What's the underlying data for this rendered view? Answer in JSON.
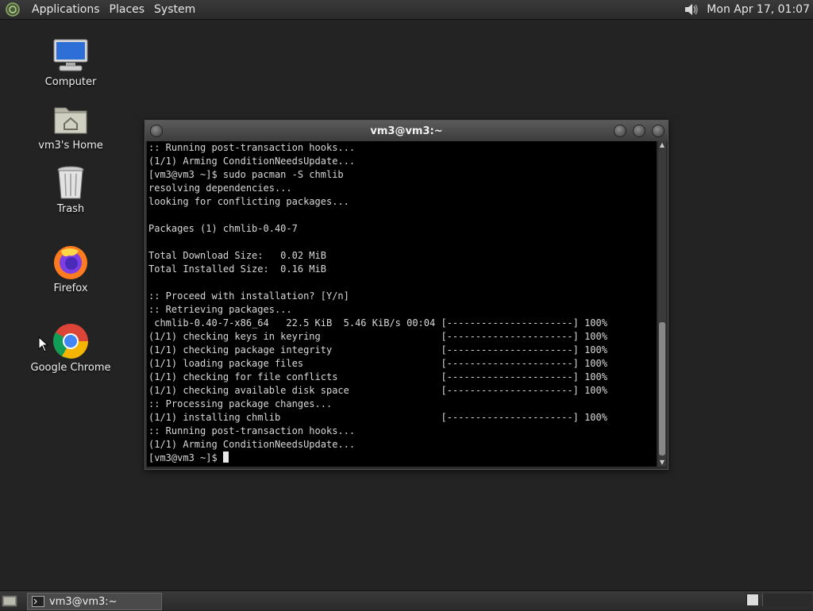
{
  "top_panel": {
    "menus": [
      "Applications",
      "Places",
      "System"
    ],
    "clock": "Mon Apr 17, 01:07",
    "logo_icon": "distro-logo-icon",
    "volume_icon": "volume-icon"
  },
  "desktop_icons": [
    {
      "label": "Computer",
      "icon": "computer-icon"
    },
    {
      "label": "vm3's Home",
      "icon": "home-folder-icon"
    },
    {
      "label": "Trash",
      "icon": "trash-icon"
    },
    {
      "label": "Firefox",
      "icon": "firefox-icon"
    },
    {
      "label": "Google Chrome",
      "icon": "chrome-icon"
    }
  ],
  "terminal": {
    "title": "vm3@vm3:~",
    "lines": [
      ":: Running post-transaction hooks...",
      "(1/1) Arming ConditionNeedsUpdate...",
      "[vm3@vm3 ~]$ sudo pacman -S chmlib",
      "resolving dependencies...",
      "looking for conflicting packages...",
      "",
      "Packages (1) chmlib-0.40-7",
      "",
      "Total Download Size:   0.02 MiB",
      "Total Installed Size:  0.16 MiB",
      "",
      ":: Proceed with installation? [Y/n]",
      ":: Retrieving packages...",
      " chmlib-0.40-7-x86_64   22.5 KiB  5.46 KiB/s 00:04 [----------------------] 100%",
      "(1/1) checking keys in keyring                     [----------------------] 100%",
      "(1/1) checking package integrity                   [----------------------] 100%",
      "(1/1) loading package files                        [----------------------] 100%",
      "(1/1) checking for file conflicts                  [----------------------] 100%",
      "(1/1) checking available disk space                [----------------------] 100%",
      ":: Processing package changes...",
      "(1/1) installing chmlib                            [----------------------] 100%",
      ":: Running post-transaction hooks...",
      "(1/1) Arming ConditionNeedsUpdate..."
    ],
    "prompt": "[vm3@vm3 ~]$ "
  },
  "bottom_panel": {
    "task_label": "vm3@vm3:~"
  }
}
